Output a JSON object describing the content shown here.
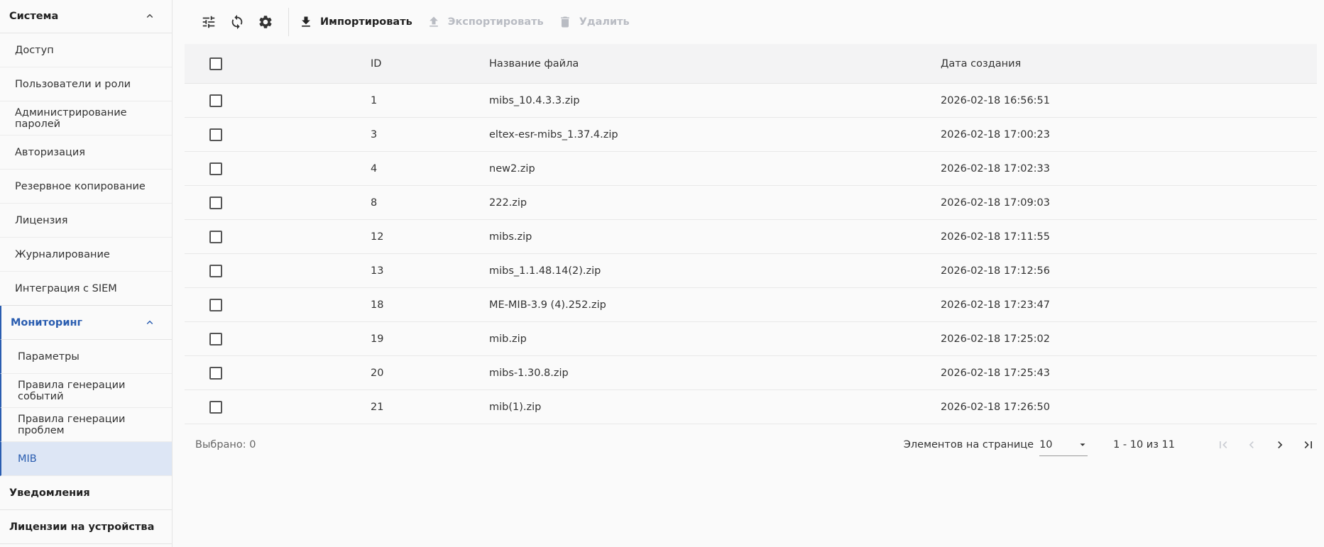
{
  "sidebar": {
    "system": {
      "title": "Система",
      "items": [
        "Доступ",
        "Пользователи и роли",
        "Администрирование паролей",
        "Авторизация",
        "Резервное копирование",
        "Лицензия",
        "Журналирование",
        "Интеграция с SIEM"
      ]
    },
    "monitoring": {
      "title": "Мониторинг",
      "items": [
        "Параметры",
        "Правила генерации событий",
        "Правила генерации проблем",
        "MIB"
      ],
      "selected": "MIB"
    },
    "notifications": {
      "title": "Уведомления"
    },
    "device_licenses": {
      "title": "Лицензии на устройства"
    }
  },
  "toolbar": {
    "import_label": "Импортировать",
    "export_label": "Экспортировать",
    "delete_label": "Удалить"
  },
  "table": {
    "headers": {
      "id": "ID",
      "name": "Название файла",
      "date": "Дата создания"
    },
    "rows": [
      {
        "id": "1",
        "name": "mibs_10.4.3.3.zip",
        "date": "2026-02-18 16:56:51"
      },
      {
        "id": "3",
        "name": "eltex-esr-mibs_1.37.4.zip",
        "date": "2026-02-18 17:00:23"
      },
      {
        "id": "4",
        "name": "new2.zip",
        "date": "2026-02-18 17:02:33"
      },
      {
        "id": "8",
        "name": "222.zip",
        "date": "2026-02-18 17:09:03"
      },
      {
        "id": "12",
        "name": "mibs.zip",
        "date": "2026-02-18 17:11:55"
      },
      {
        "id": "13",
        "name": "mibs_1.1.48.14(2).zip",
        "date": "2026-02-18 17:12:56"
      },
      {
        "id": "18",
        "name": "ME-MIB-3.9 (4).252.zip",
        "date": "2026-02-18 17:23:47"
      },
      {
        "id": "19",
        "name": "mib.zip",
        "date": "2026-02-18 17:25:02"
      },
      {
        "id": "20",
        "name": "mibs-1.30.8.zip",
        "date": "2026-02-18 17:25:43"
      },
      {
        "id": "21",
        "name": "mib(1).zip",
        "date": "2026-02-18 17:26:50"
      }
    ]
  },
  "footer": {
    "selected_label": "Выбрано: 0",
    "per_page_label": "Элементов на странице",
    "per_page_value": "10",
    "range_label": "1 - 10 из 11"
  },
  "colors": {
    "accent": "#2a5db0",
    "selected_bg": "#dde6f5",
    "disabled": "#b9bcc3"
  }
}
